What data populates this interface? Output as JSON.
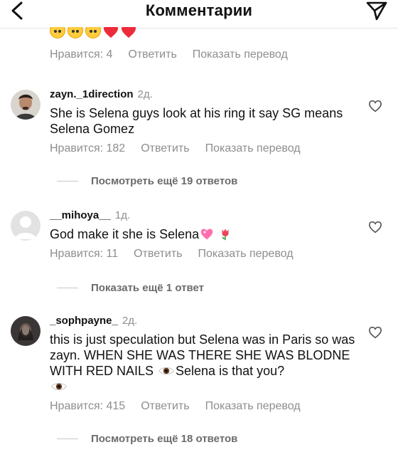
{
  "header": {
    "title": "Комментарии",
    "back_icon": "chevron-left-icon",
    "send_icon": "paper-plane-icon"
  },
  "top_comment": {
    "emojis": [
      "pleading-face",
      "crying-face",
      "crying-face",
      "red-heart",
      "red-heart"
    ],
    "likes": "Нравится: 4",
    "reply": "Ответить",
    "translate": "Показать перевод"
  },
  "comments": [
    {
      "username": "zayn._1direction",
      "age": "2д.",
      "text": "She is Selena guys look at his ring it say SG means Selena Gomez",
      "likes": "Нравится: 182",
      "reply": "Ответить",
      "translate": "Показать перевод",
      "more_replies": "Посмотреть ещё 19 ответов"
    },
    {
      "username": "__mihoya__",
      "age": "1д.",
      "text": "God make it she is Selena",
      "emojis": [
        "sparkling-heart",
        "tulip"
      ],
      "likes": "Нравится: 11",
      "reply": "Ответить",
      "translate": "Показать перевод",
      "more_replies": "Показать ещё 1 ответ"
    },
    {
      "username": "_sophpayne_",
      "age": "2д.",
      "text_part1": "this is just speculation but Selena was in Paris so was zayn.  WHEN SHE WAS THERE SHE WAS BLODNE WITH RED NAILS ",
      "text_part2": "Selena is that you?",
      "emoji": "eye",
      "likes": "Нравится: 415",
      "reply": "Ответить",
      "translate": "Показать перевод",
      "more_replies": "Посмотреть ещё 18 ответов"
    }
  ],
  "colors": {
    "text": "#111111",
    "secondary": "#8e8e8e",
    "heart_red": "#ed2b3a"
  }
}
